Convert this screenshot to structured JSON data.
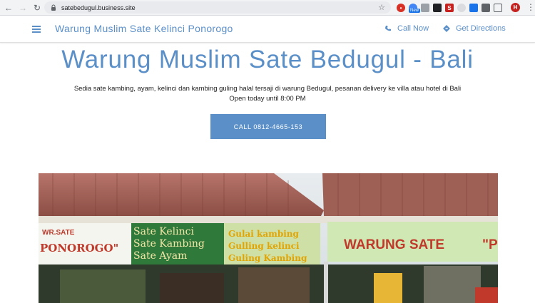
{
  "browser": {
    "url": "satebedugul.business.site",
    "extensions": [
      {
        "icon": "adblock-icon",
        "color": "#d93025"
      },
      {
        "icon": "new-extension-icon",
        "color": "#4285f4"
      },
      {
        "icon": "document-icon",
        "color": "#9aa0a6"
      },
      {
        "icon": "qr-icon",
        "color": "#202124"
      },
      {
        "icon": "s-extension-icon",
        "color": "#c5221f"
      },
      {
        "icon": "circle-extension-icon",
        "color": "#dadce0"
      },
      {
        "icon": "translate-icon",
        "color": "#1a73e8"
      },
      {
        "icon": "grid-extension-icon",
        "color": "#5f6368"
      },
      {
        "icon": "cast-icon",
        "color": "#5f6368"
      }
    ],
    "new_badge": "New",
    "avatar_letter": "H"
  },
  "header": {
    "site_name": "Warung Muslim Sate Kelinci Ponorogo",
    "call_now": "Call Now",
    "get_directions": "Get Directions"
  },
  "hero": {
    "title": "Warung Muslim Sate Bedugul - Bali",
    "description": "Sedia sate kambing, ayam, kelinci dan kambing guling halal tersaji di warung Bedugul, pesanan delivery ke villa atau hotel di Bali",
    "hours": "Open today until 8:00 PM",
    "call_button": "CALL 0812-4665-153"
  },
  "photo": {
    "signs": {
      "left_banner": "WR.SATE",
      "left_banner_2": "PONOROGO\"",
      "middle_line_1": "Sate Kelinci",
      "middle_line_2": "Sate Kambing",
      "middle_line_3": "Sate Ayam",
      "right_line_1": "Gulai kambing",
      "right_line_2": "Gulling kelinci",
      "right_line_3": "Guling Kambing",
      "far_right": "WARUNG SATE",
      "far_right_quote": "\"P"
    }
  },
  "colors": {
    "accent": "#5b8fc8",
    "button_text": "#ffffff"
  }
}
